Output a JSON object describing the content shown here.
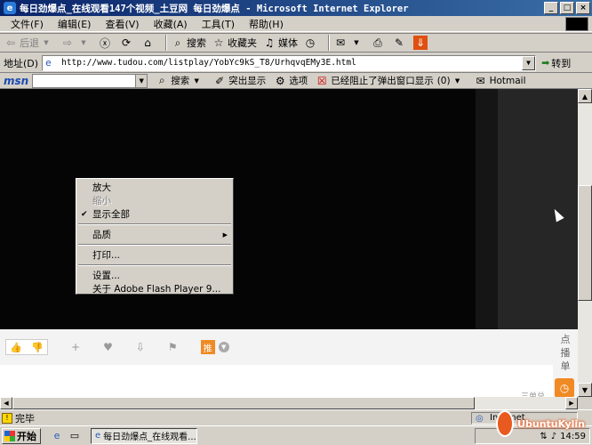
{
  "window": {
    "title": "每日劲爆点_在线观看147个视频_土豆网 每日劲爆点 - Microsoft Internet Explorer",
    "controls": [
      "_",
      "□",
      "×"
    ]
  },
  "menubar": {
    "items": [
      "文件(F)",
      "编辑(E)",
      "查看(V)",
      "收藏(A)",
      "工具(T)",
      "帮助(H)"
    ]
  },
  "toolbar": {
    "back_label": "后退",
    "search_label": "搜索",
    "favorites_label": "收藏夹",
    "media_label": "媒体"
  },
  "address": {
    "label": "地址(D)",
    "url": "http://www.tudou.com/listplay/YobYc9kS_T8/UrhqvqEMy3E.html",
    "go_label": "转到"
  },
  "msnbar": {
    "logo": "msn",
    "search_label": "搜索",
    "highlight_label": "突出显示",
    "options_label": "选项",
    "popup_label": "已经阻止了弹出窗口显示",
    "popup_count": "(0)",
    "hotmail_label": "Hotmail"
  },
  "context_menu": {
    "items": [
      {
        "label": "放大",
        "enabled": true
      },
      {
        "label": "缩小",
        "enabled": false
      },
      {
        "label": "显示全部",
        "enabled": true,
        "checked": true
      },
      {
        "label": "品质",
        "enabled": true,
        "submenu": true
      },
      {
        "label": "打印...",
        "enabled": true
      },
      {
        "label": "设置...",
        "enabled": true
      },
      {
        "label": "关于 Adobe Flash Player 9...",
        "enabled": true
      }
    ]
  },
  "page": {
    "push_label": "推",
    "side_label": [
      "点",
      "播",
      "单"
    ],
    "mini_text": "三单兑"
  },
  "status": {
    "text": "完毕",
    "zone": "Internet"
  },
  "taskbar": {
    "start_label": "开始",
    "task_label": "每日劲爆点_在线观看...",
    "clock": "14:59",
    "watermark": "UbuntuKylin"
  },
  "colors": {
    "titlebar": "#0a246a",
    "accent": "#f08a24"
  }
}
